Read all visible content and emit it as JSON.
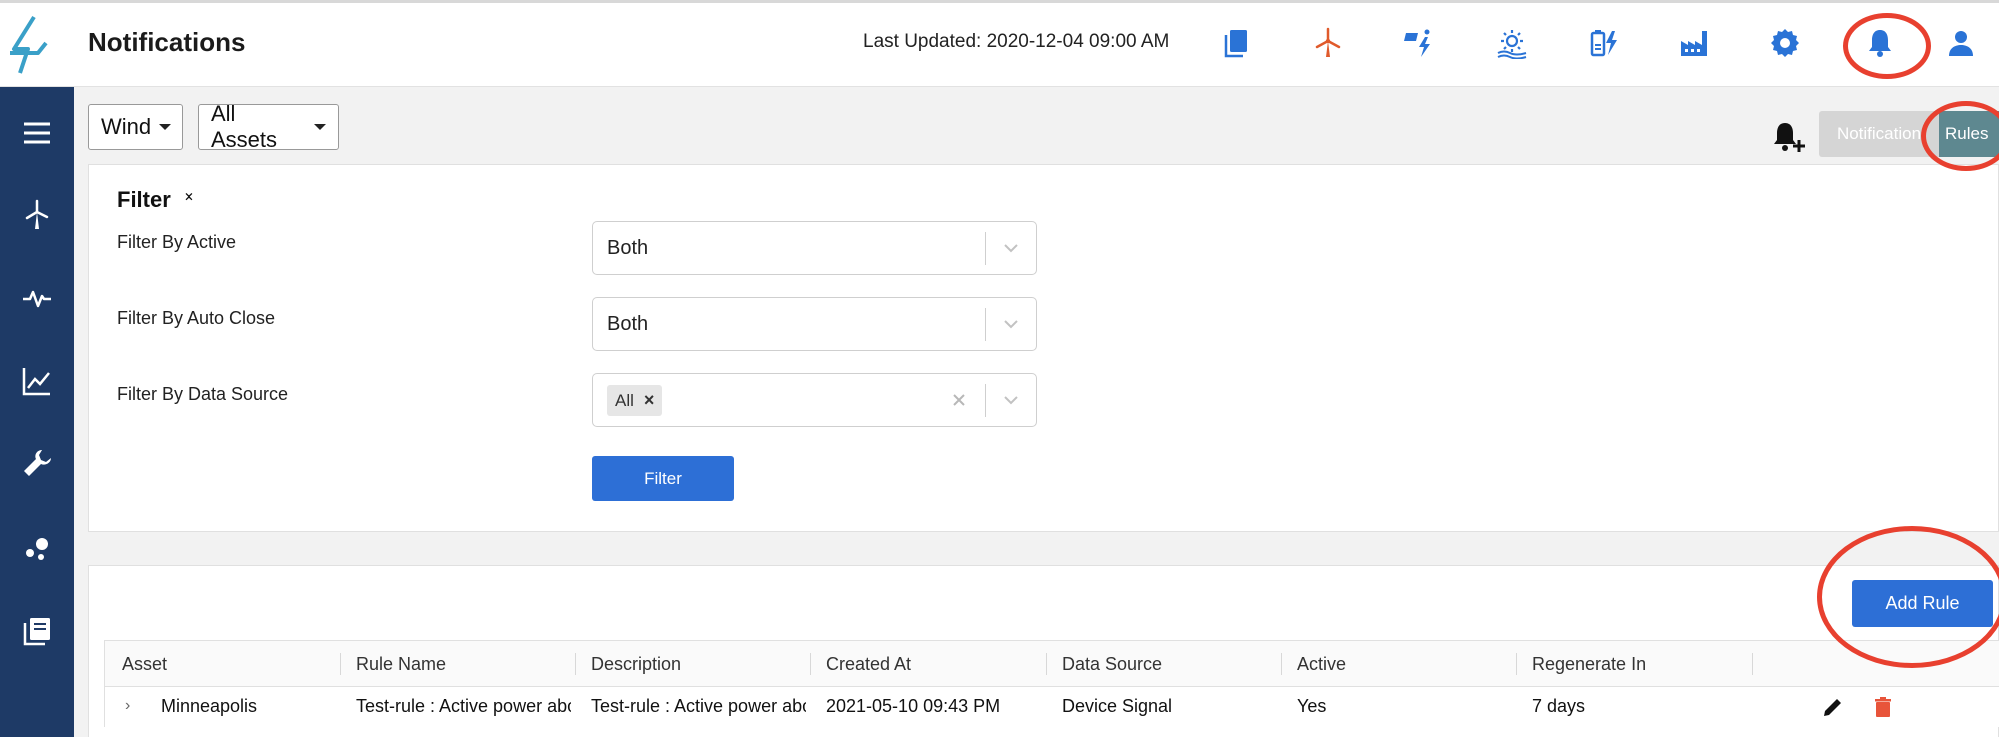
{
  "header": {
    "title": "Notifications",
    "last_updated": "Last Updated: 2020-12-04 09:00 AM",
    "icons": [
      "documents-icon",
      "wind-turbine-icon",
      "solar-power-icon",
      "solar-sun-icon",
      "battery-charging-icon",
      "factory-icon",
      "settings-gear-icon",
      "bell-icon",
      "user-icon"
    ]
  },
  "sidebar": {
    "icons": [
      "menu-icon",
      "wind-turbine-icon",
      "activity-pulse-icon",
      "line-chart-icon",
      "wrench-icon",
      "scatter-icon",
      "library-icon"
    ]
  },
  "toolbar": {
    "type_select": "Wind",
    "asset_select": "All Assets",
    "toggle_notification": "Notification",
    "toggle_rules": "Rules"
  },
  "filter": {
    "title": "Filter",
    "active_label": "Filter By Active",
    "active_value": "Both",
    "autoclose_label": "Filter By Auto Close",
    "autoclose_value": "Both",
    "datasource_label": "Filter By Data Source",
    "datasource_chip": "All",
    "button": "Filter"
  },
  "rules": {
    "add_button": "Add Rule",
    "columns": [
      "Asset",
      "Rule Name",
      "Description",
      "Created At",
      "Data Source",
      "Active",
      "Regenerate In"
    ],
    "rows": [
      {
        "asset": "Minneapolis",
        "rule_name": "Test-rule : Active power abo",
        "description": "Test-rule : Active power abo",
        "created_at": "2021-05-10 09:43 PM",
        "data_source": "Device Signal",
        "active": "Yes",
        "regenerate_in": "7 days"
      }
    ]
  },
  "colors": {
    "sidebar": "#1e3a66",
    "primary_button": "#2d6fd6",
    "header_icon_blue": "#2a73d6",
    "wind_icon": "#e05a2b",
    "annotation_red": "#e8402f",
    "rules_toggle": "#5e8890",
    "delete_icon": "#e8543a"
  }
}
